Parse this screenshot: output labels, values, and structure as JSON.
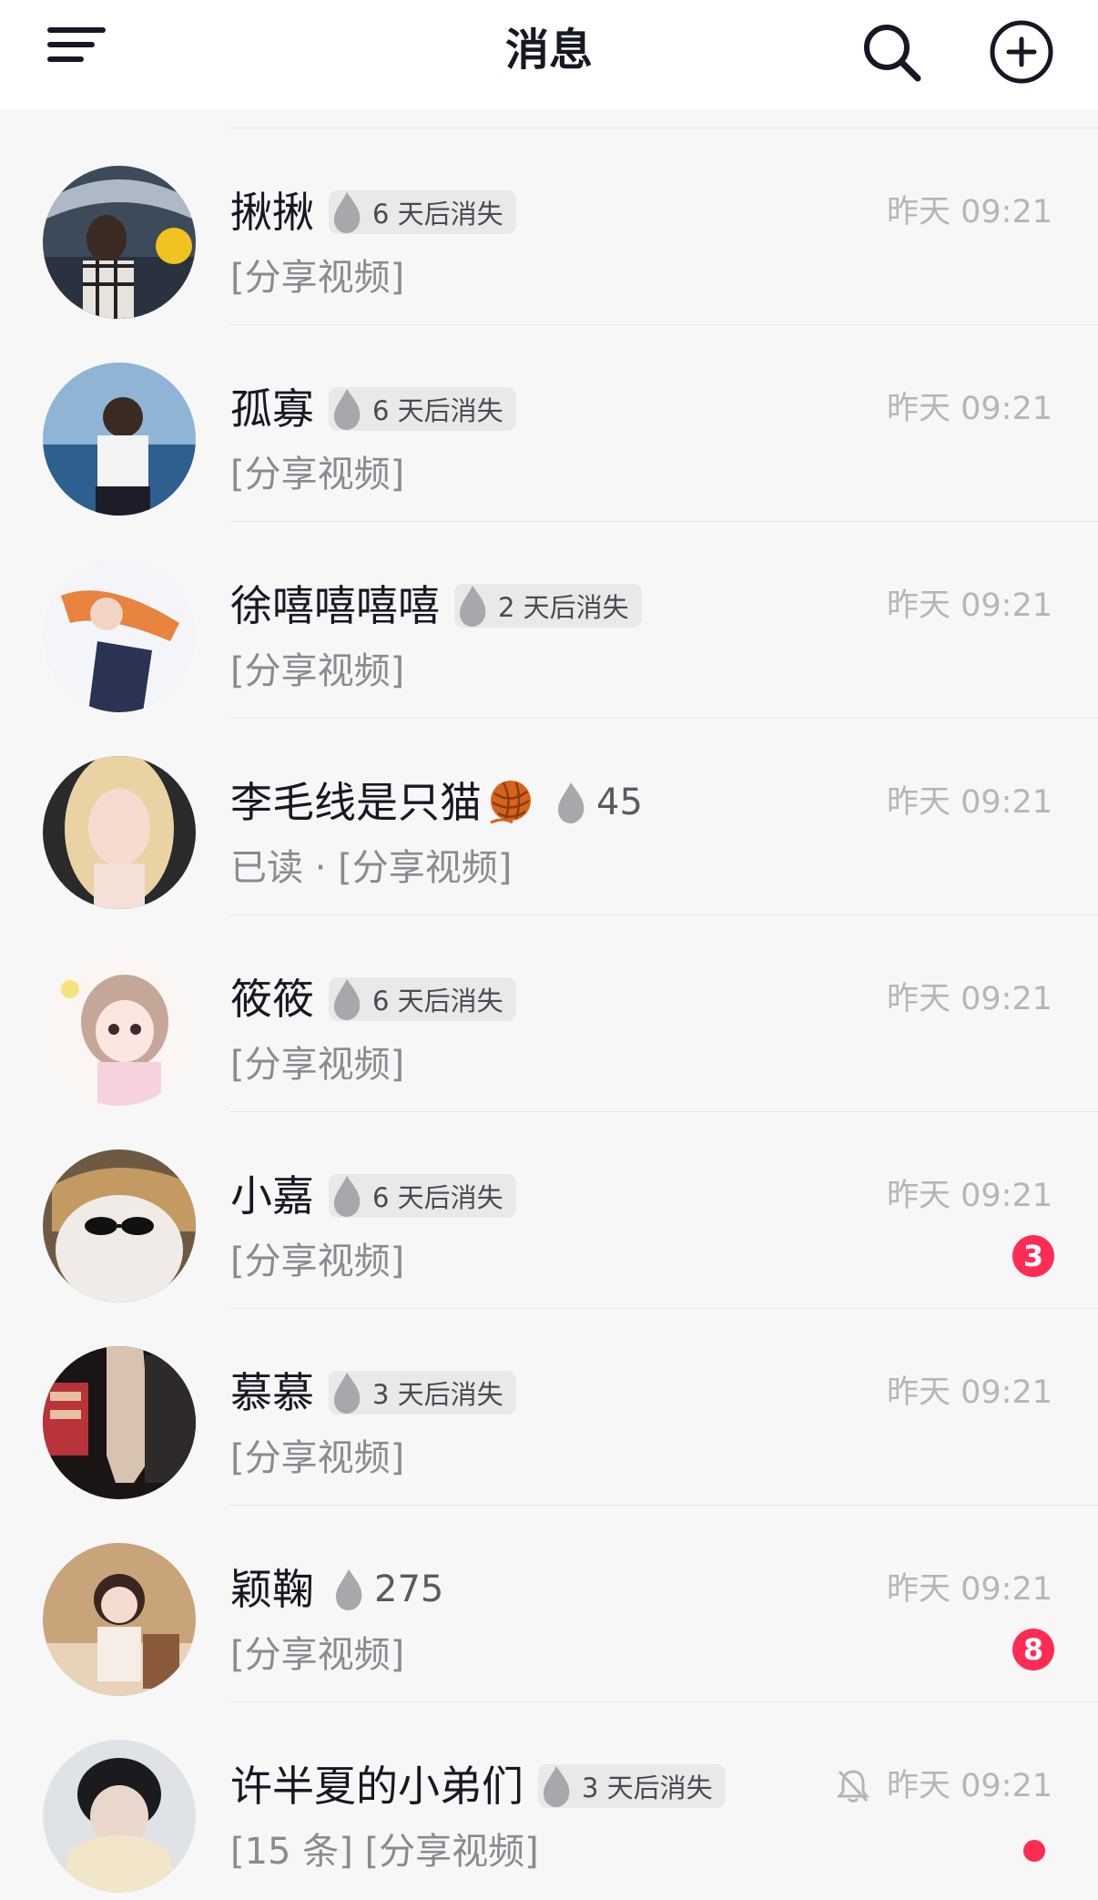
{
  "header": {
    "title": "消息",
    "menu_icon": "menu-icon",
    "search_icon": "search-icon",
    "add_icon": "add-circle-icon"
  },
  "colors": {
    "background": "#f7f7f7",
    "header_background": "#ffffff",
    "badge": "#fe2c55",
    "time_text": "#b5b6ba",
    "subtitle_text": "#8a8b91"
  },
  "conversations": [
    {
      "name": "揪揪",
      "spark": "6 天后消失",
      "time": "昨天 09:21",
      "subtitle": "[分享视频]"
    },
    {
      "name": "孤寡",
      "spark": "6 天后消失",
      "time": "昨天 09:21",
      "subtitle": "[分享视频]"
    },
    {
      "name": "徐嘻嘻嘻嘻",
      "spark": "2 天后消失",
      "time": "昨天 09:21",
      "subtitle": "[分享视频]"
    },
    {
      "name": "李毛线是只猫",
      "emoji": "yarn-ball-icon",
      "spark": "45",
      "time": "昨天 09:21",
      "subtitle": "已读 · [分享视频]"
    },
    {
      "name": "筱筱",
      "spark": "6 天后消失",
      "time": "昨天 09:21",
      "subtitle": "[分享视频]"
    },
    {
      "name": "小嘉",
      "spark": "6 天后消失",
      "time": "昨天 09:21",
      "subtitle": "[分享视频]",
      "unread": "3"
    },
    {
      "name": "慕慕",
      "spark": "3 天后消失",
      "time": "昨天 09:21",
      "subtitle": "[分享视频]"
    },
    {
      "name": "颖鞠",
      "spark": "275",
      "time": "昨天 09:21",
      "subtitle": "[分享视频]",
      "unread": "8"
    },
    {
      "name": "许半夏的小弟们",
      "spark": "3 天后消失",
      "time": "昨天 09:21",
      "subtitle": "[15 条] [分享视频]",
      "muted": true,
      "unread_dot": true
    }
  ]
}
